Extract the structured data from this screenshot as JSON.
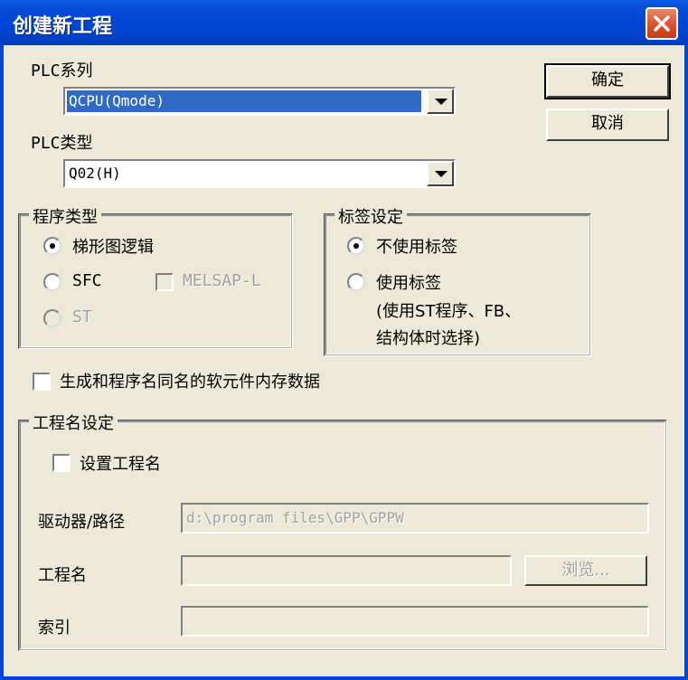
{
  "dialog": {
    "title": "创建新工程"
  },
  "plc_series": {
    "label": "PLC系列",
    "value": "QCPU(Qmode)"
  },
  "plc_type": {
    "label": "PLC类型",
    "value": "Q02(H)"
  },
  "buttons": {
    "ok": "确定",
    "cancel": "取消",
    "browse": "浏览..."
  },
  "program_type": {
    "legend": "程序类型",
    "ladder": "梯形图逻辑",
    "sfc": "SFC",
    "melsap": "MELSAP-L",
    "st": "ST"
  },
  "label_setting": {
    "legend": "标签设定",
    "no_label": "不使用标签",
    "use_label": "使用标签",
    "note_line1": "(使用ST程序、FB、",
    "note_line2": "结构体时选择)"
  },
  "generate_device_memory": "生成和程序名同名的软元件内存数据",
  "project_name_setting": {
    "legend": "工程名设定",
    "set_name": "设置工程名",
    "drive_path_label": "驱动器/路径",
    "drive_path_value": "d:\\program files\\GPP\\GPPW",
    "project_name_label": "工程名",
    "project_name_value": "",
    "index_label": "索引",
    "index_value": ""
  },
  "colors": {
    "titlebar": "#0046d5",
    "dialog_bg": "#ece9d8",
    "selection": "#316ac5",
    "close": "#d9502e"
  }
}
